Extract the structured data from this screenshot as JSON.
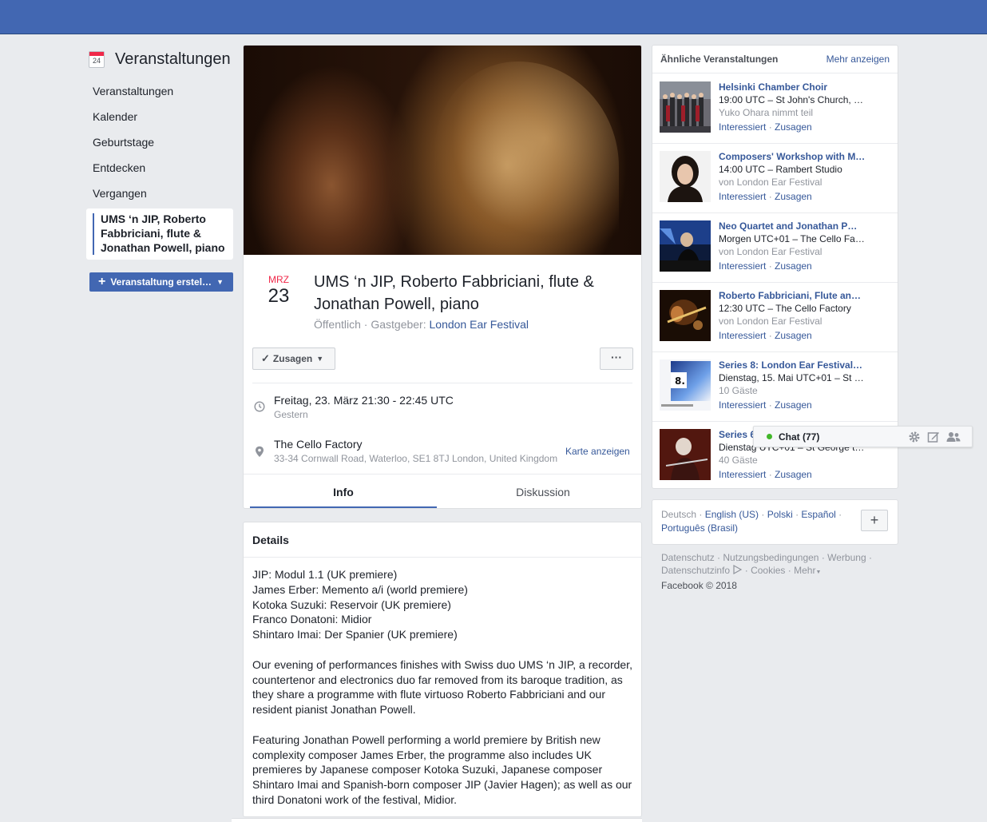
{
  "sidebar": {
    "title": "Veranstaltungen",
    "calendar_icon_day": "24",
    "items": [
      {
        "label": "Veranstaltungen"
      },
      {
        "label": "Kalender"
      },
      {
        "label": "Geburtstage"
      },
      {
        "label": "Entdecken"
      },
      {
        "label": "Vergangen"
      }
    ],
    "selected_event": "UMS ‘n JIP, Roberto Fabbriciani, flute & Jonathan Powell, piano",
    "create_button": "Veranstaltung erstel…"
  },
  "event": {
    "month": "MRZ",
    "day": "23",
    "title": "UMS ‘n JIP, Roberto Fabbriciani, flute & Jonathan Powell, piano",
    "privacy": "Öffentlich",
    "host_prefix": "Gastgeber:",
    "host": "London Ear Festival",
    "going_button": "Zusagen",
    "more_button": "···",
    "time": "Freitag, 23. März 21:30 - 22:45 UTC",
    "time_relative": "Gestern",
    "venue": "The Cello Factory",
    "address": "33-34 Cornwall Road, Waterloo, SE1 8TJ London, United Kingdom",
    "map_link": "Karte anzeigen",
    "tabs": [
      "Info",
      "Diskussion"
    ]
  },
  "details": {
    "heading": "Details",
    "program": [
      "JIP: Modul 1.1 (UK premiere)",
      "James Erber: Memento a/i (world premiere)",
      "Kotoka Suzuki: Reservoir (UK premiere)",
      "Franco Donatoni: Midior",
      "Shintaro Imai: Der Spanier (UK premiere)"
    ],
    "paragraph1": "Our evening of performances finishes with Swiss duo UMS ‘n JIP, a recorder, countertenor and electronics duo far removed from its baroque tradition, as they share a programme with flute virtuoso Roberto Fabbriciani and our resident pianist Jonathan Powell.",
    "paragraph2": "Featuring Jonathan Powell performing a world premiere by British new complexity composer James Erber, the programme also includes UK premieres by Japanese composer Kotoka Suzuki, Japanese composer Shintaro Imai and Spanish-born composer JIP (Javier Hagen); as well as our third Donatoni work of the festival, Midior."
  },
  "similar": {
    "heading": "Ähnliche Veranstaltungen",
    "more_link": "Mehr anzeigen",
    "interested": "Interessiert",
    "going": "Zusagen",
    "items": [
      {
        "name": "Helsinki Chamber Choir",
        "line1": "19:00 UTC – St John's Church, …",
        "line2": "Yuko Ohara nimmt teil"
      },
      {
        "name": "Composers' Workshop with M…",
        "line1": "14:00 UTC – Rambert Studio",
        "line2": "von London Ear Festival"
      },
      {
        "name": "Neo Quartet and Jonathan P…",
        "line1": "Morgen UTC+01 – The Cello Fa…",
        "line2": "von London Ear Festival"
      },
      {
        "name": "Roberto Fabbriciani, Flute an…",
        "line1": "12:30 UTC – The Cello Factory",
        "line2": "von London Ear Festival"
      },
      {
        "name": "Series 8: London Ear Festival…",
        "line1": "Dienstag, 15. Mai UTC+01 – St …",
        "line2": "10 Gäste"
      },
      {
        "name": "Series 6",
        "line1": "Dienstag UTC+01 – St George t…",
        "line2": "40 Gäste"
      }
    ]
  },
  "chat": {
    "label": "Chat (77)"
  },
  "languages": {
    "current": "Deutsch",
    "others": [
      "English (US)",
      "Polski",
      "Español",
      "Português (Brasil)"
    ],
    "add_label": "+"
  },
  "footer": {
    "links": [
      "Datenschutz",
      "Nutzungsbedingungen",
      "Werbung",
      "Datenschutzinfo",
      "Cookies",
      "Mehr"
    ],
    "copyright": "Facebook © 2018"
  }
}
